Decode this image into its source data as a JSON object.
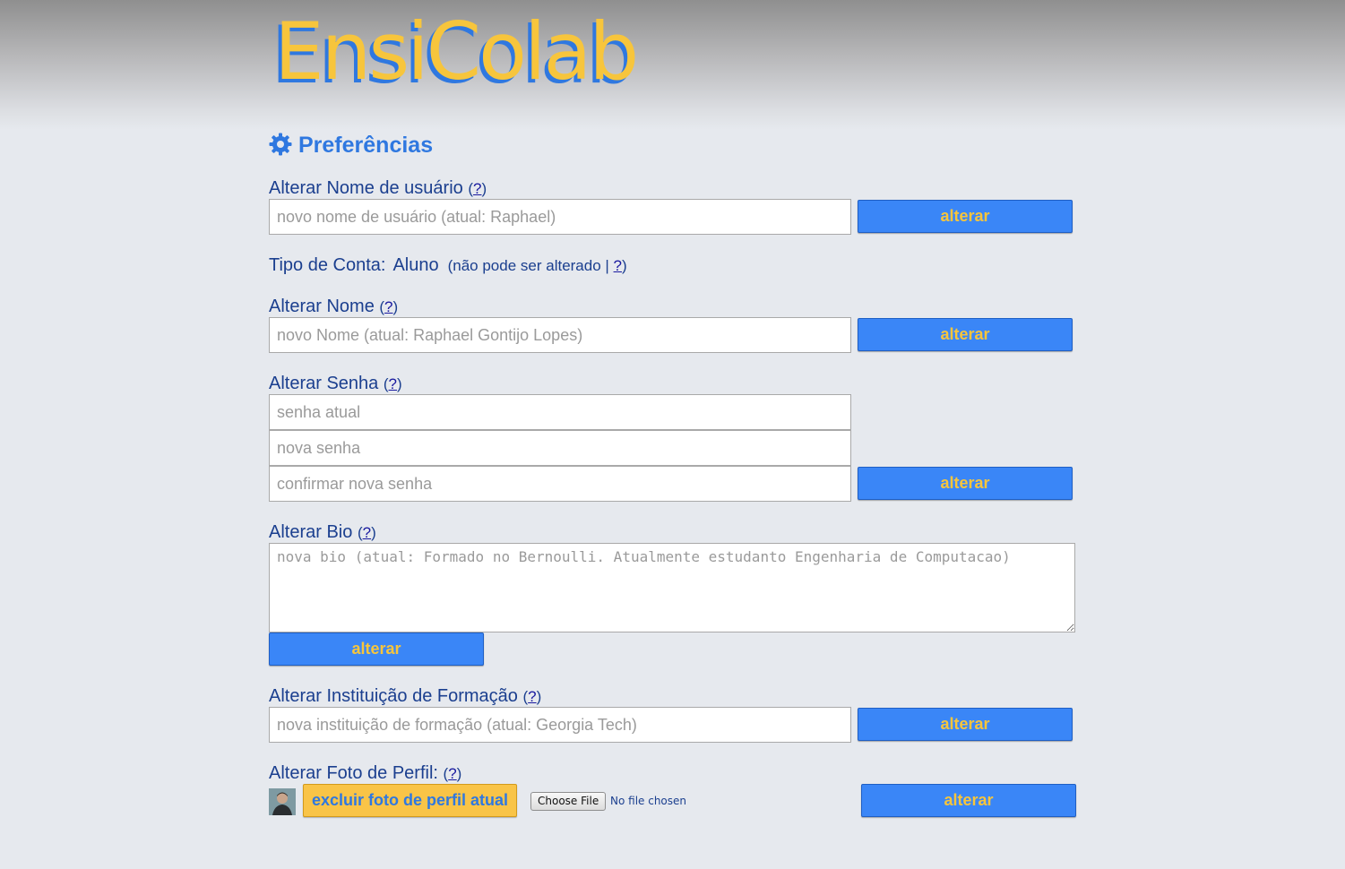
{
  "app": {
    "logo_text": "EnsiColab"
  },
  "page": {
    "title": "Preferências",
    "title_icon": "gear-icon"
  },
  "help_link": "?",
  "username": {
    "label": "Alterar Nome de usuário",
    "placeholder": "novo nome de usuário (atual: Raphael)",
    "button": "alterar"
  },
  "account_type": {
    "label": "Tipo de Conta:",
    "value": "Aluno",
    "note_prefix": "(não pode ser alterado |",
    "note_suffix": ")"
  },
  "name": {
    "label": "Alterar Nome",
    "placeholder": "novo Nome (atual: Raphael Gontijo Lopes)",
    "button": "alterar"
  },
  "password": {
    "label": "Alterar Senha",
    "current_placeholder": "senha atual",
    "new_placeholder": "nova senha",
    "confirm_placeholder": "confirmar nova senha",
    "button": "alterar"
  },
  "bio": {
    "label": "Alterar Bio",
    "placeholder": "nova bio (atual: Formado no Bernoulli. Atualmente estudanto Engenharia de Computacao)",
    "button": "alterar"
  },
  "institution": {
    "label": "Alterar Instituição de Formação",
    "placeholder": "nova instituição de formação (atual: Georgia Tech)",
    "button": "alterar"
  },
  "photo": {
    "label": "Alterar Foto de Perfil:",
    "delete_button": "excluir foto de perfil atual",
    "choose_file": "Choose File",
    "file_status": "No file chosen",
    "button": "alterar"
  },
  "colors": {
    "brand_blue": "#2f78e0",
    "brand_yellow": "#f7c53c",
    "button_blue": "#3a86f7",
    "label_navy": "#1b3f8f"
  }
}
